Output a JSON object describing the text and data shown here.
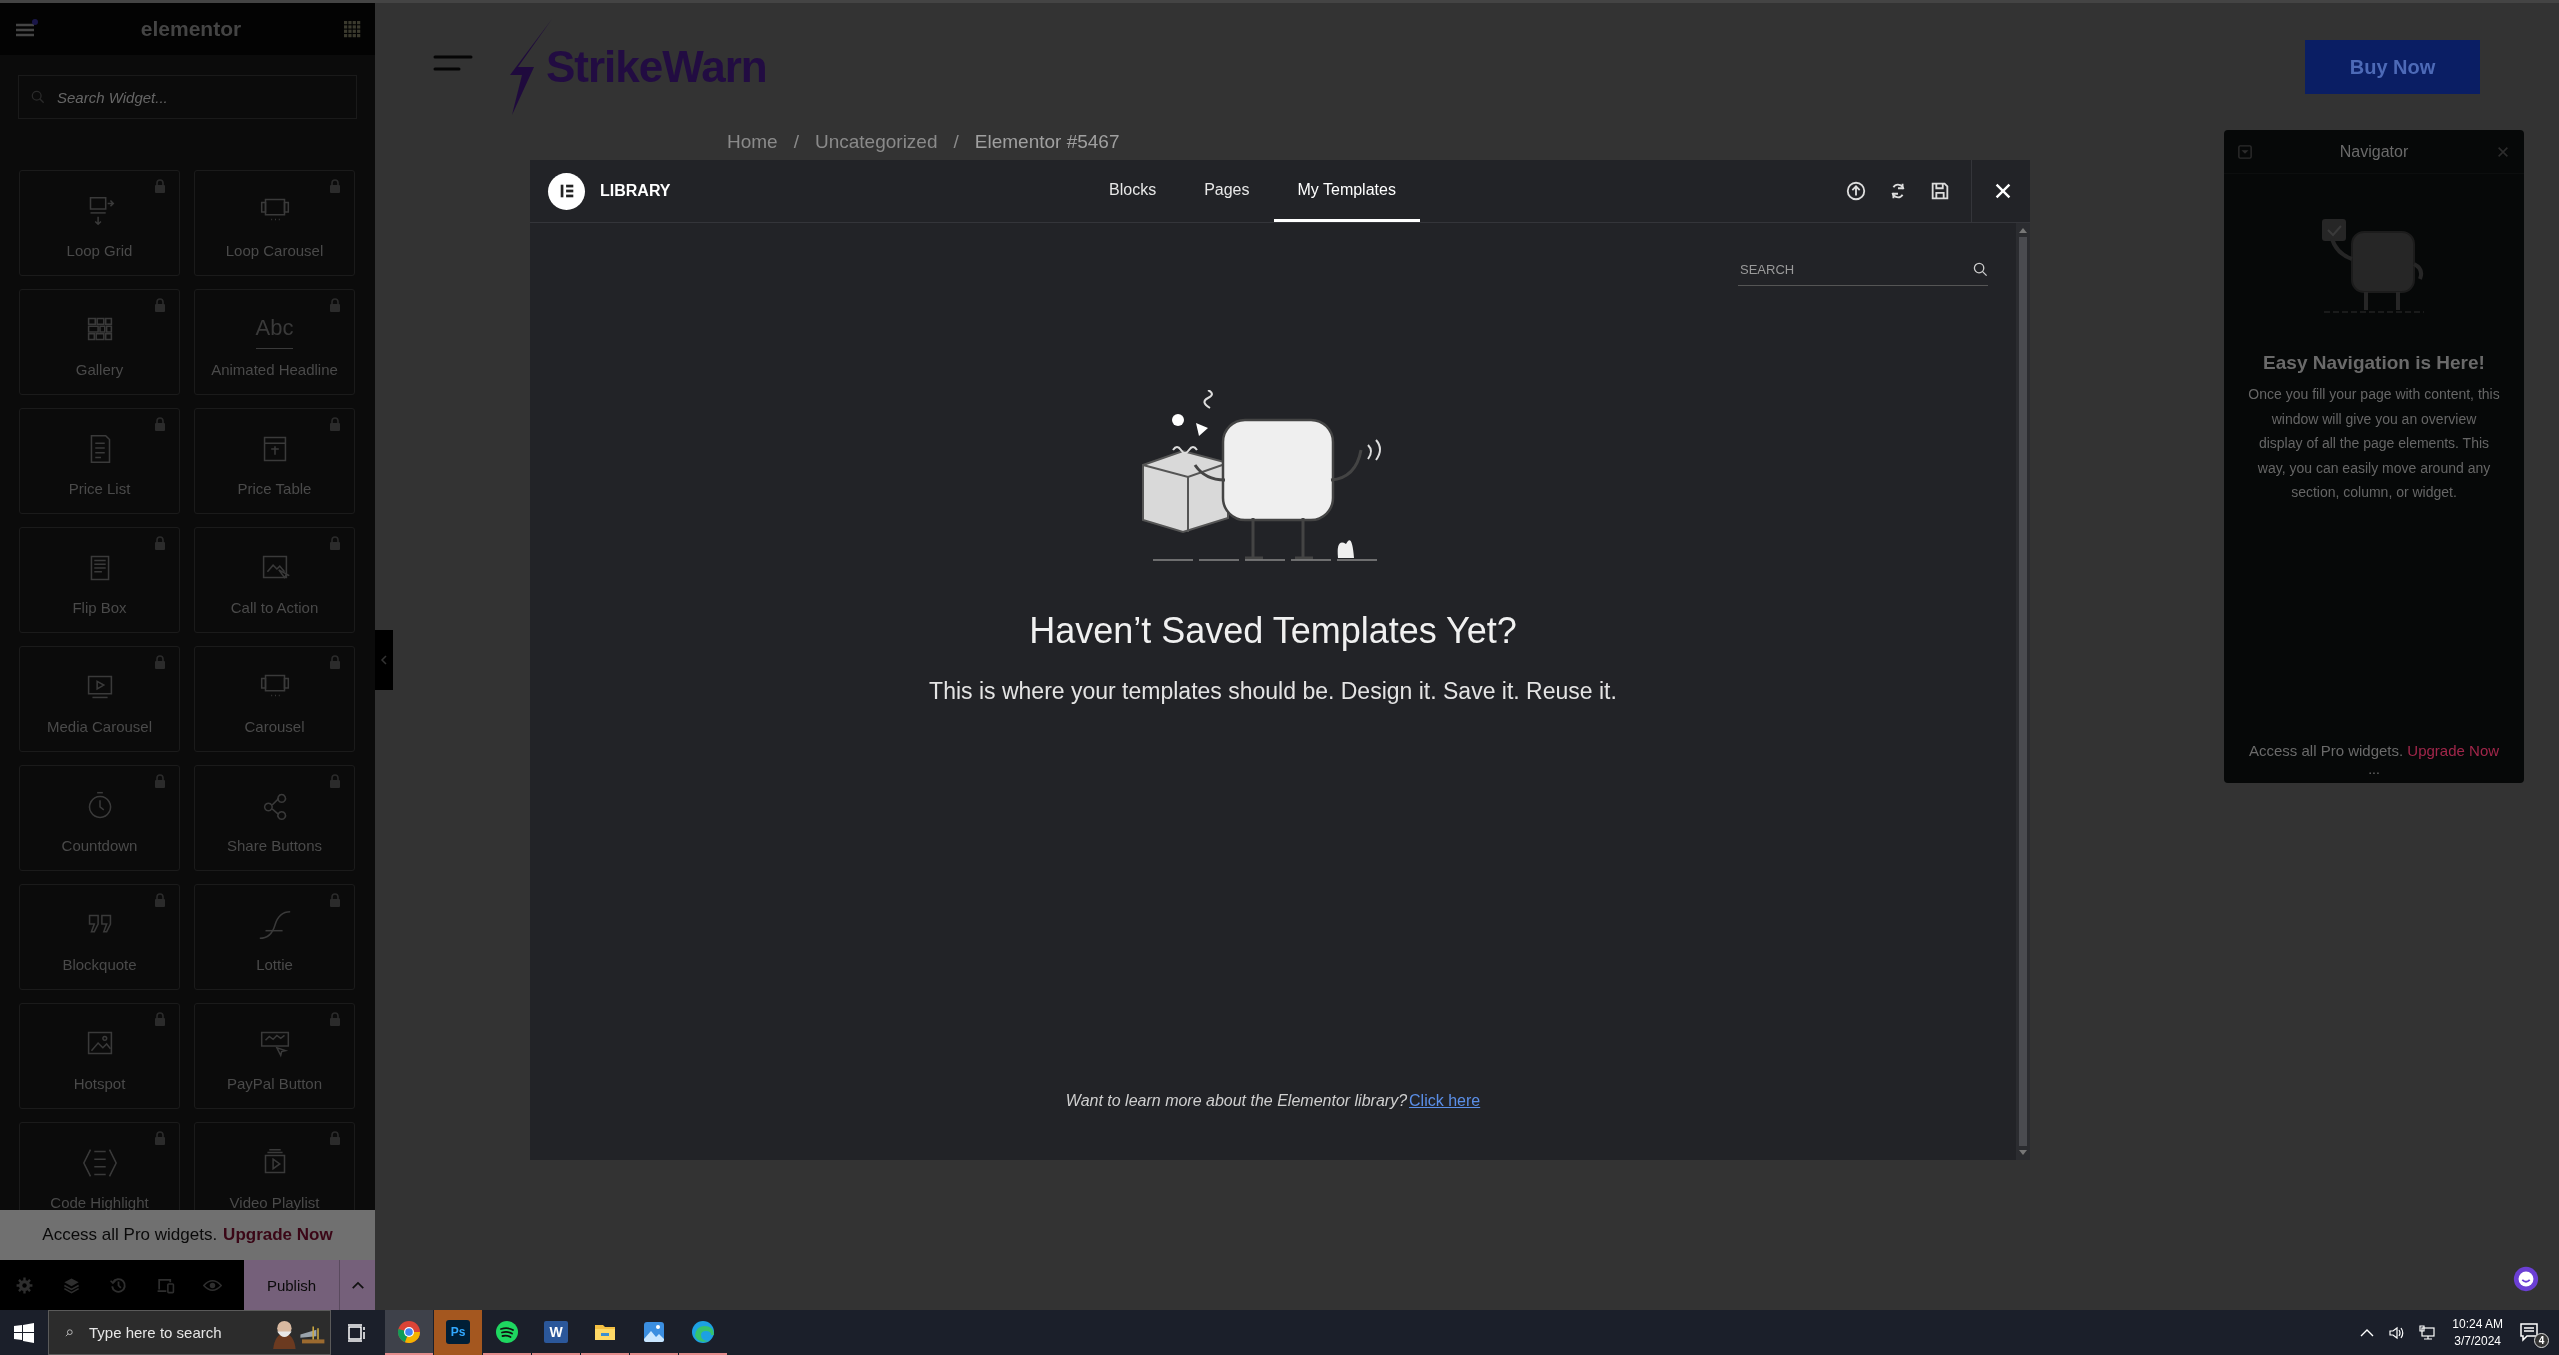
{
  "sidebar": {
    "logo": "elementor",
    "search": {
      "placeholder": "Search Widget..."
    },
    "headline_icon_text": "Abc",
    "widgets": [
      {
        "kind": "loop-grid",
        "label": "Loop Grid",
        "locked": true
      },
      {
        "kind": "carousel",
        "label": "Loop Carousel",
        "locked": true
      },
      {
        "kind": "gallery",
        "label": "Gallery",
        "locked": true
      },
      {
        "kind": "headline",
        "label": "Animated Headline",
        "locked": true
      },
      {
        "kind": "list",
        "label": "Price List",
        "locked": true
      },
      {
        "kind": "table",
        "label": "Price Table",
        "locked": true
      },
      {
        "kind": "flip",
        "label": "Flip Box",
        "locked": true
      },
      {
        "kind": "cta",
        "label": "Call to Action",
        "locked": true
      },
      {
        "kind": "media",
        "label": "Media Carousel",
        "locked": true
      },
      {
        "kind": "carousel",
        "label": "Carousel",
        "locked": true
      },
      {
        "kind": "countdown",
        "label": "Countdown",
        "locked": true
      },
      {
        "kind": "share",
        "label": "Share Buttons",
        "locked": true
      },
      {
        "kind": "quote",
        "label": "Blockquote",
        "locked": true
      },
      {
        "kind": "lottie",
        "label": "Lottie",
        "locked": true
      },
      {
        "kind": "hotspot",
        "label": "Hotspot",
        "locked": true
      },
      {
        "kind": "paypal",
        "label": "PayPal Button",
        "locked": true
      },
      {
        "kind": "code",
        "label": "Code Highlight",
        "locked": true
      },
      {
        "kind": "video",
        "label": "Video Playlist",
        "locked": true
      }
    ],
    "promo": {
      "text": "Access all Pro widgets.",
      "link": "Upgrade Now"
    },
    "publish": "Publish"
  },
  "page": {
    "brand": "StrikeWarn",
    "buy_button": "Buy Now",
    "breadcrumb": [
      "Home",
      "Uncategorized",
      "Elementor #5467"
    ],
    "separator": "/"
  },
  "library": {
    "title": "LIBRARY",
    "tabs": [
      {
        "label": "Blocks",
        "selected": false
      },
      {
        "label": "Pages",
        "selected": false
      },
      {
        "label": "My Templates",
        "selected": true
      }
    ],
    "search": {
      "placeholder": "SEARCH"
    },
    "empty_title": "Haven’t Saved Templates Yet?",
    "empty_text": "This is where your templates should be. Design it. Save it. Reuse it.",
    "footer_text": "Want to learn more about the Elementor library?",
    "footer_link": "Click here"
  },
  "navigator": {
    "title": "Navigator",
    "heading": "Easy Navigation is Here!",
    "text": "Once you fill your page with content, this window will give you an overview display of all the page elements. This way, you can easily move around any section, column, or widget.",
    "promo": "Access all Pro widgets.",
    "promo_link": "Upgrade Now",
    "more": "..."
  },
  "taskbar": {
    "search_placeholder": "Type here to search",
    "apps": [
      {
        "kind": "chrome",
        "selected": true,
        "flashing": false
      },
      {
        "kind": "photoshop",
        "label": "Ps",
        "selected": false,
        "flashing": true
      },
      {
        "kind": "spotify",
        "selected": false,
        "flashing": false
      },
      {
        "kind": "word",
        "label": "W",
        "selected": false,
        "flashing": false
      },
      {
        "kind": "explorer",
        "selected": false,
        "flashing": false
      },
      {
        "kind": "photos",
        "selected": false,
        "flashing": false
      },
      {
        "kind": "edge",
        "selected": false,
        "flashing": false
      }
    ],
    "time": "10:24 AM",
    "date": "3/7/2024",
    "notifications": "4"
  }
}
